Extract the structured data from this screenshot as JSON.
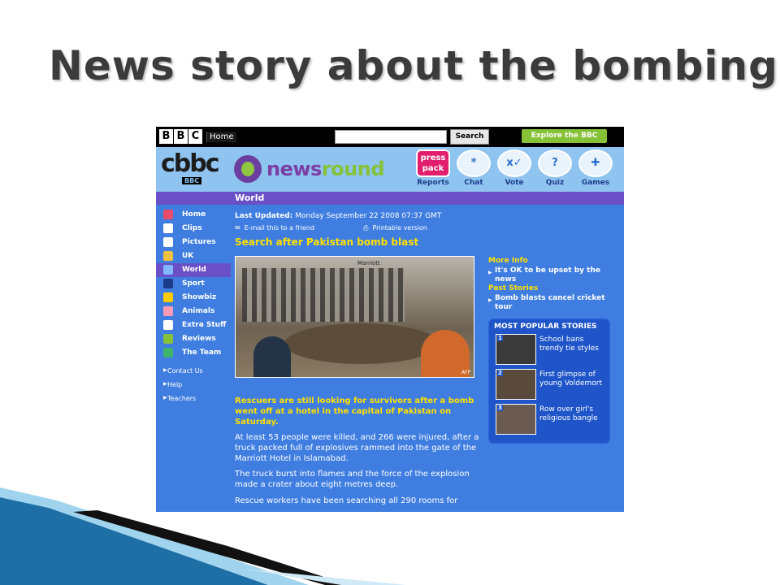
{
  "slide": {
    "title": "News story about the bombing"
  },
  "bbc": {
    "logo_letters": [
      "B",
      "B",
      "C"
    ],
    "home_label": "Home",
    "search_button": "Search",
    "search_value": "",
    "explore_button": "Explore the BBC"
  },
  "header": {
    "cbbc_logo": "cbbc",
    "cbbc_sub": "BBC",
    "newsround_prefix": "news",
    "newsround_suffix": "round",
    "nav": [
      {
        "label": "Reports",
        "glyph": "press pack",
        "icon": "press-pack-icon"
      },
      {
        "label": "Chat",
        "glyph": "*",
        "icon": "chat-icon"
      },
      {
        "label": "Vote",
        "glyph": "x✓",
        "icon": "vote-icon"
      },
      {
        "label": "Quiz",
        "glyph": "?",
        "icon": "quiz-icon"
      },
      {
        "label": "Games",
        "glyph": "✚",
        "icon": "games-icon"
      }
    ]
  },
  "section": {
    "title": "World"
  },
  "sidebar": {
    "items": [
      {
        "label": "Home",
        "icon": "home-icon",
        "color": "#e84a6a"
      },
      {
        "label": "Clips",
        "icon": "clips-icon",
        "color": "#ffffff"
      },
      {
        "label": "Pictures",
        "icon": "camera-icon",
        "color": "#ffffff"
      },
      {
        "label": "UK",
        "icon": "uk-icon",
        "color": "#f0c040"
      },
      {
        "label": "World",
        "icon": "globe-icon",
        "color": "#7fb7ff"
      },
      {
        "label": "Sport",
        "icon": "sport-icon",
        "color": "#1a3a8a"
      },
      {
        "label": "Showbiz",
        "icon": "star-icon",
        "color": "#ffcc00"
      },
      {
        "label": "Animals",
        "icon": "animal-icon",
        "color": "#ff9ab6"
      },
      {
        "label": "Extra Stuff",
        "icon": "bulb-icon",
        "color": "#ffffff"
      },
      {
        "label": "Reviews",
        "icon": "reviews-icon",
        "color": "#86c238"
      },
      {
        "label": "The Team",
        "icon": "team-icon",
        "color": "#3fb36b"
      }
    ],
    "active_index": 4,
    "links": [
      {
        "label": "Contact Us"
      },
      {
        "label": "Help"
      },
      {
        "label": "Teachers"
      }
    ]
  },
  "article": {
    "updated_label": "Last Updated:",
    "updated_value": "Monday September 22 2008 07:37 GMT",
    "email_link": "E-mail this to a friend",
    "print_link": "Printable version",
    "headline": "Search after Pakistan bomb blast",
    "photo_sign": "Marriott",
    "photo_credit": "AFP",
    "lead": "Rescuers are still looking for survivors after a bomb went off at a hotel in the capital of Pakistan on Saturday.",
    "paragraphs": [
      "At least 53 people were killed, and 266 were injured, after a truck packed full of explosives rammed into the gate of the Marriott Hotel in Islamabad.",
      "The truck burst into flames and the force of the explosion made a crater about eight metres deep.",
      "Rescue workers have been searching all 290 rooms for"
    ]
  },
  "right_column": {
    "more_info_heading": "More Info",
    "more_info_link": "It's OK to be upset by the news",
    "past_stories_heading": "Past Stories",
    "past_stories_link": "Bomb blasts cancel cricket tour",
    "popular_title": "MOST POPULAR STORIES",
    "popular": [
      {
        "num": "1",
        "text": "School bans trendy tie styles"
      },
      {
        "num": "2",
        "text": "First glimpse of young Voldemort"
      },
      {
        "num": "3",
        "text": "Row over girl's religious bangle"
      }
    ]
  },
  "colors": {
    "page_bg": "#3f7ee0",
    "headline": "#ffe000",
    "section_bar": "#6a50c6",
    "explore": "#86c238",
    "popular_box": "#1f55c8"
  }
}
